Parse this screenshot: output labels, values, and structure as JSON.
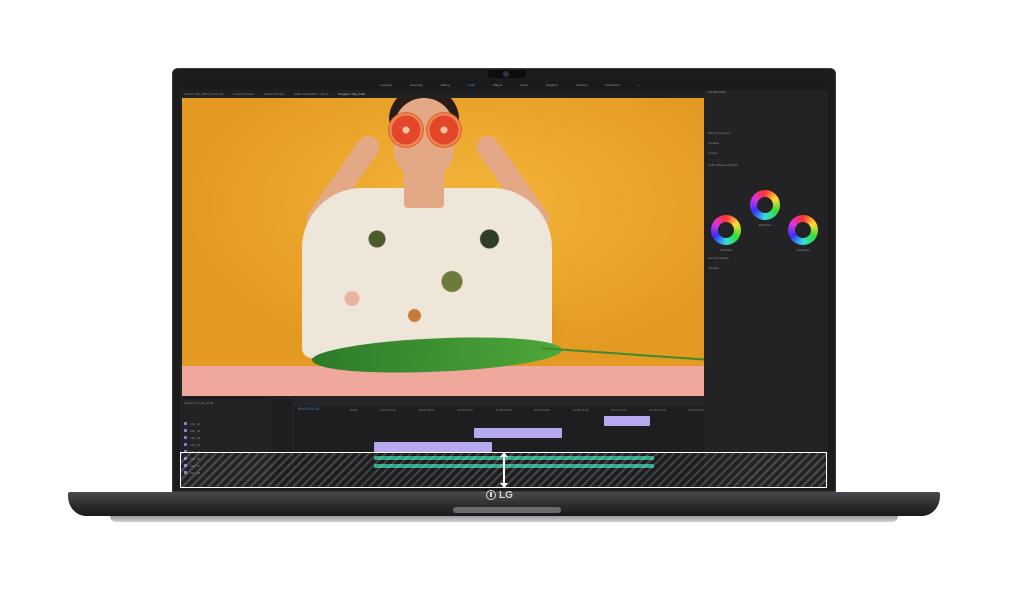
{
  "brand": {
    "name": "LG"
  },
  "app": {
    "workspaces": [
      "Learning",
      "Assembly",
      "Editing",
      "Color",
      "Effects",
      "Audio",
      "Graphics",
      "Libraries",
      "Production",
      "»"
    ],
    "active_workspace": "Color",
    "panel_tabs": [
      "Source: Clip_Main_Final.mp4",
      "Lumetri Scopes",
      "Effect Controls",
      "Audio Track Mixer: Clip_A",
      "Program: Clip_Final"
    ],
    "active_panel_tab": "Program: Clip_Final",
    "right_panel": {
      "title": "Lumetri Color",
      "sections": [
        "Basic Correction",
        "Creative",
        "Curves",
        "Color Wheels & Match",
        "HSL Secondary",
        "Vignette"
      ],
      "wheels": [
        "Shadows",
        "Midtones",
        "Highlights"
      ]
    },
    "timeline": {
      "timecode": "00:00:01:19",
      "ruler": [
        "00:00",
        "00:00:02:00",
        "00:00:04:00",
        "00:00:06:00",
        "00:00:08:00",
        "00:00:10:00",
        "00:00:12:00",
        "00:00:14:00",
        "00:00:16:00",
        "00:00:18:00"
      ]
    },
    "project": {
      "title": "Project: Lumetri_Final",
      "items": [
        "Clip_01",
        "Clip_02",
        "Clip_03",
        "Clip_04",
        "Clip_05",
        "Clip_06",
        "Clip_07",
        "Clip_08"
      ]
    }
  },
  "colors": {
    "accent": "#3d8ce8",
    "clip_purple": "#b8a8f0",
    "clip_green": "#2fa88a",
    "wall": "#e9a72a"
  }
}
